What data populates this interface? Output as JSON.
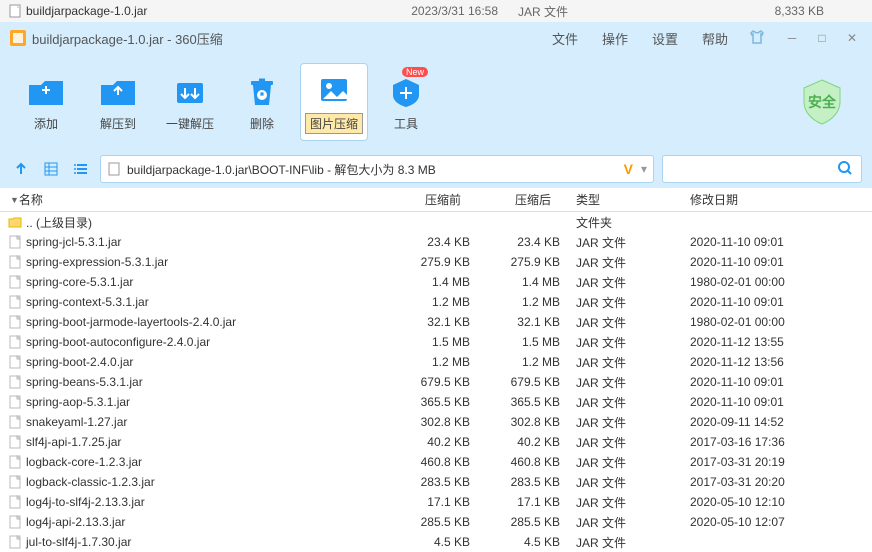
{
  "explorer_row": {
    "name": "buildjarpackage-1.0.jar",
    "date": "2023/3/31 16:58",
    "type": "JAR 文件",
    "size": "8,333 KB"
  },
  "window": {
    "title": "buildjarpackage-1.0.jar - 360压缩"
  },
  "menu": {
    "file": "文件",
    "operation": "操作",
    "settings": "设置",
    "help": "帮助"
  },
  "toolbar": {
    "add": "添加",
    "extract": "解压到",
    "oneclick": "一键解压",
    "delete": "删除",
    "imgcompress": "图片压缩",
    "tools": "工具",
    "badge_new": "New",
    "safety": "安全"
  },
  "pathbar": {
    "path": "buildjarpackage-1.0.jar\\BOOT-INF\\lib - 解包大小为 8.3 MB"
  },
  "columns": {
    "name": "名称",
    "before": "压缩前",
    "after": "压缩后",
    "type": "类型",
    "date": "修改日期"
  },
  "parent_dir": {
    "name": ".. (上级目录)",
    "type": "文件夹"
  },
  "files": [
    {
      "name": "spring-jcl-5.3.1.jar",
      "before": "23.4 KB",
      "after": "23.4 KB",
      "type": "JAR 文件",
      "date": "2020-11-10 09:01"
    },
    {
      "name": "spring-expression-5.3.1.jar",
      "before": "275.9 KB",
      "after": "275.9 KB",
      "type": "JAR 文件",
      "date": "2020-11-10 09:01"
    },
    {
      "name": "spring-core-5.3.1.jar",
      "before": "1.4 MB",
      "after": "1.4 MB",
      "type": "JAR 文件",
      "date": "1980-02-01 00:00"
    },
    {
      "name": "spring-context-5.3.1.jar",
      "before": "1.2 MB",
      "after": "1.2 MB",
      "type": "JAR 文件",
      "date": "2020-11-10 09:01"
    },
    {
      "name": "spring-boot-jarmode-layertools-2.4.0.jar",
      "before": "32.1 KB",
      "after": "32.1 KB",
      "type": "JAR 文件",
      "date": "1980-02-01 00:00"
    },
    {
      "name": "spring-boot-autoconfigure-2.4.0.jar",
      "before": "1.5 MB",
      "after": "1.5 MB",
      "type": "JAR 文件",
      "date": "2020-11-12 13:55"
    },
    {
      "name": "spring-boot-2.4.0.jar",
      "before": "1.2 MB",
      "after": "1.2 MB",
      "type": "JAR 文件",
      "date": "2020-11-12 13:56"
    },
    {
      "name": "spring-beans-5.3.1.jar",
      "before": "679.5 KB",
      "after": "679.5 KB",
      "type": "JAR 文件",
      "date": "2020-11-10 09:01"
    },
    {
      "name": "spring-aop-5.3.1.jar",
      "before": "365.5 KB",
      "after": "365.5 KB",
      "type": "JAR 文件",
      "date": "2020-11-10 09:01"
    },
    {
      "name": "snakeyaml-1.27.jar",
      "before": "302.8 KB",
      "after": "302.8 KB",
      "type": "JAR 文件",
      "date": "2020-09-11 14:52"
    },
    {
      "name": "slf4j-api-1.7.25.jar",
      "before": "40.2 KB",
      "after": "40.2 KB",
      "type": "JAR 文件",
      "date": "2017-03-16 17:36"
    },
    {
      "name": "logback-core-1.2.3.jar",
      "before": "460.8 KB",
      "after": "460.8 KB",
      "type": "JAR 文件",
      "date": "2017-03-31 20:19"
    },
    {
      "name": "logback-classic-1.2.3.jar",
      "before": "283.5 KB",
      "after": "283.5 KB",
      "type": "JAR 文件",
      "date": "2017-03-31 20:20"
    },
    {
      "name": "log4j-to-slf4j-2.13.3.jar",
      "before": "17.1 KB",
      "after": "17.1 KB",
      "type": "JAR 文件",
      "date": "2020-05-10 12:10"
    },
    {
      "name": "log4j-api-2.13.3.jar",
      "before": "285.5 KB",
      "after": "285.5 KB",
      "type": "JAR 文件",
      "date": "2020-05-10 12:07"
    },
    {
      "name": "jul-to-slf4j-1.7.30.jar",
      "before": "4.5 KB",
      "after": "4.5 KB",
      "type": "JAR 文件",
      "date": ""
    }
  ]
}
